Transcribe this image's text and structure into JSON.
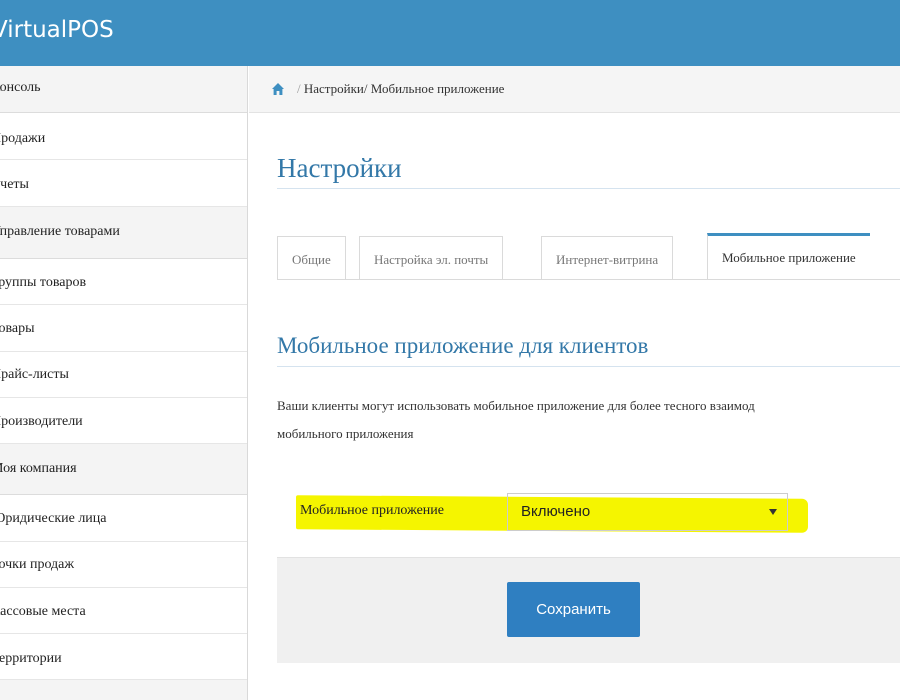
{
  "app": {
    "title": "VirtualPOS"
  },
  "sidebar": {
    "items": [
      {
        "label": "Консоль",
        "section": true
      },
      {
        "label": "Продажи",
        "section": false
      },
      {
        "label": "Счеты",
        "section": false
      },
      {
        "label": "Управление товарами",
        "section": true
      },
      {
        "label": "Группы товаров",
        "section": false
      },
      {
        "label": "Товары",
        "section": false
      },
      {
        "label": "Прайс-листы",
        "section": false
      },
      {
        "label": "Производители",
        "section": false
      },
      {
        "label": "Моя компания",
        "section": true
      },
      {
        "label": "Юридические лица",
        "section": false
      },
      {
        "label": "Точки продаж",
        "section": false
      },
      {
        "label": "Кассовые места",
        "section": false
      },
      {
        "label": "Территории",
        "section": false
      }
    ]
  },
  "breadcrumb": {
    "home_icon": "home-icon",
    "separator": "/",
    "path": "Настройки/ Мобильное приложение"
  },
  "page": {
    "title": "Настройки"
  },
  "tabs": [
    {
      "label": "Общие",
      "active": false
    },
    {
      "label": "Настройка эл. почты",
      "active": false
    },
    {
      "label": "Интернет-витрина",
      "active": false
    },
    {
      "label": "Мобильное приложение",
      "active": true
    }
  ],
  "section": {
    "title": "Мобильное приложение для клиентов",
    "description_line1": "Ваши клиенты могут использовать мобильное приложение для более тесного взаимод",
    "description_line2": "мобильного приложения"
  },
  "form": {
    "field_label": "Мобильное приложение",
    "select_value": "Включено",
    "save_label": "Сохранить"
  },
  "colors": {
    "header": "#3e8fc1",
    "accent": "#3378a8",
    "button": "#2f7fc1",
    "highlight": "#f5f500"
  }
}
